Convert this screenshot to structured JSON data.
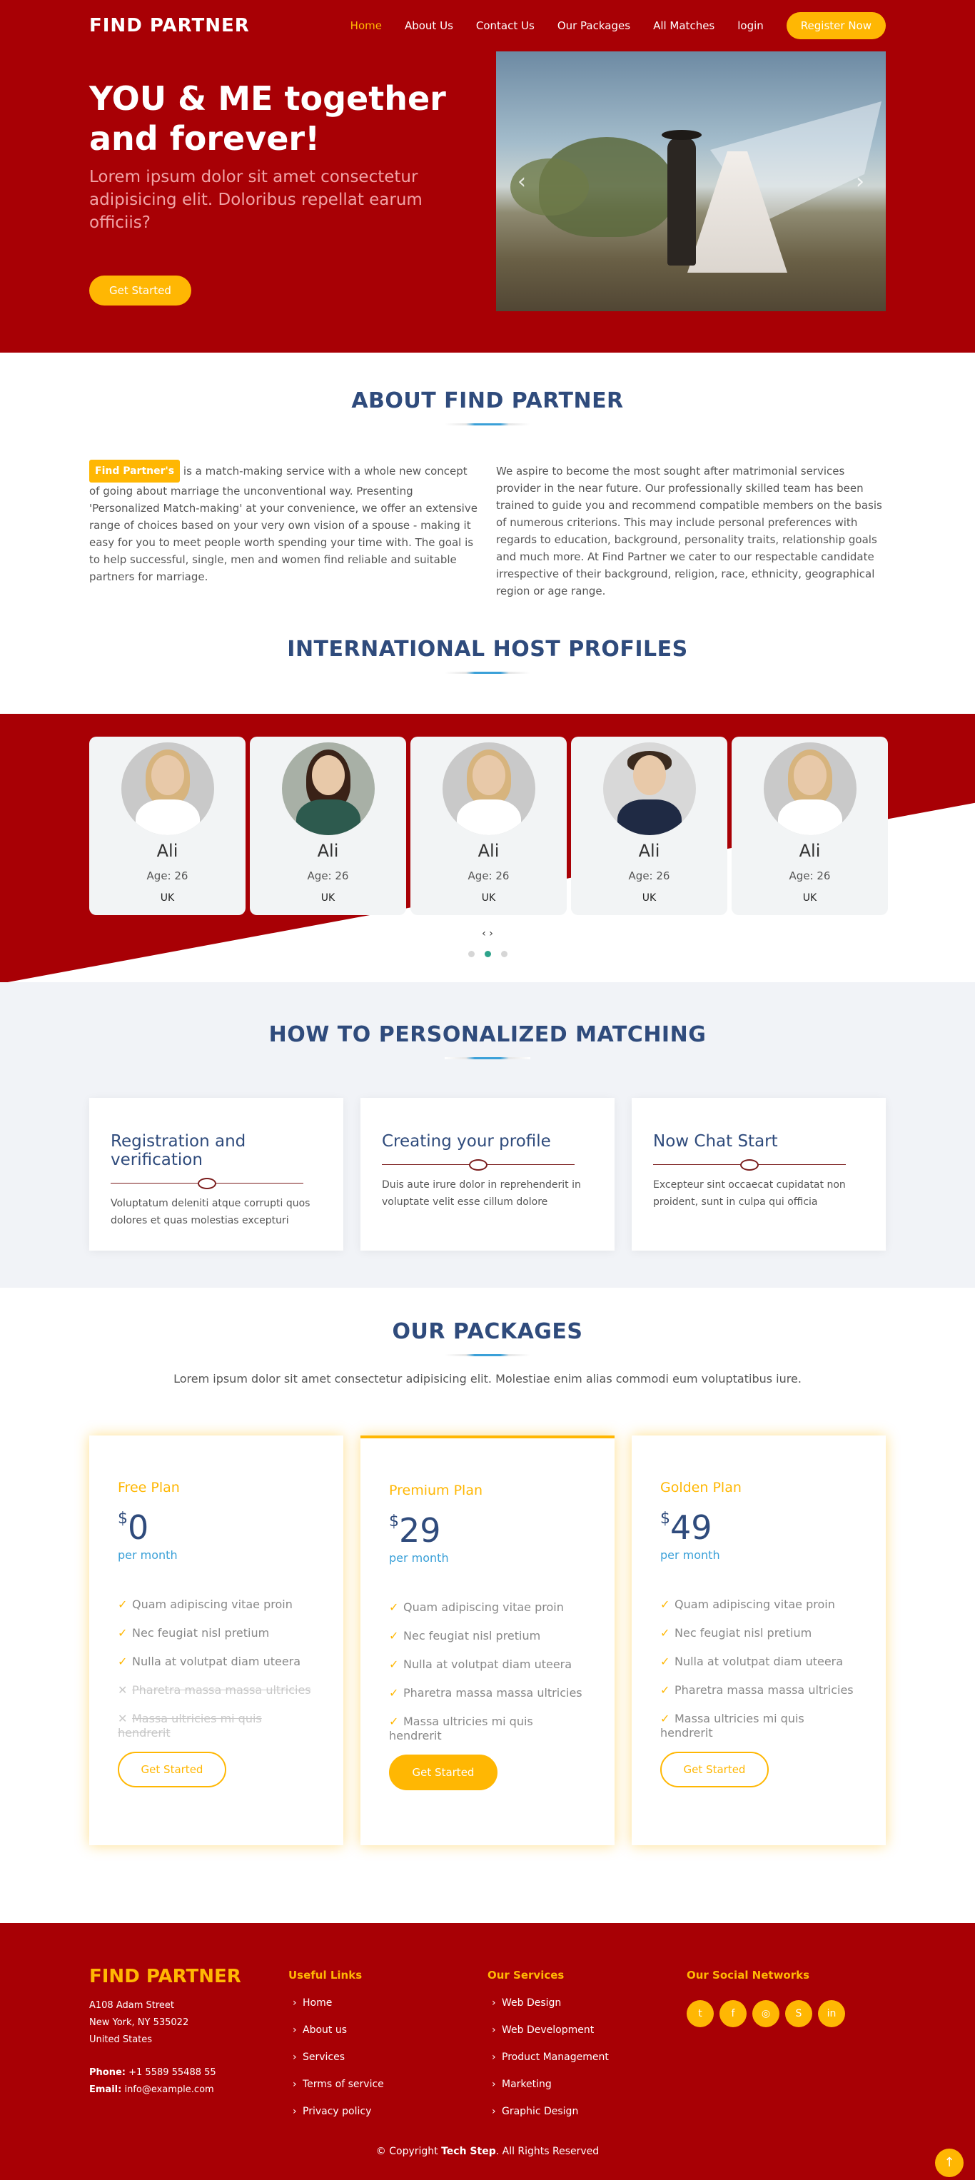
{
  "header": {
    "logo": "FIND PARTNER",
    "nav": [
      "Home",
      "About Us",
      "Contact Us",
      "Our Packages",
      "All Matches",
      "login"
    ],
    "register": "Register Now"
  },
  "hero": {
    "title": "YOU & ME together and forever!",
    "subtitle": "Lorem ipsum dolor sit amet consectetur adipisicing elit. Doloribus repellat earum officiis?",
    "cta": "Get Started",
    "prev": "‹",
    "next": "›"
  },
  "about": {
    "title": "ABOUT FIND PARTNER",
    "badge": "Find Partner's",
    "left_text": "is a match-making service with a whole new concept of going about marriage the unconventional way. Presenting 'Personalized Match-making' at your convenience, we offer an extensive range of choices based on your very own vision of a spouse - making it easy for you to meet people worth spending your time with. The goal is to help successful, single, men and women find reliable and suitable partners for marriage.",
    "right_text": "We aspire to become the most sought after matrimonial services provider in the near future. Our professionally skilled team has been trained to guide you and recommend compatible members on the basis of numerous criterions. This may include personal preferences with regards to education, background, personality traits, relationship goals and much more. At Find Partner we cater to our respectable candidate irrespective of their background, religion, race, ethnicity, geographical region or age range."
  },
  "profiles": {
    "title": "INTERNATIONAL HOST PROFILES",
    "items": [
      {
        "name": "Ali",
        "age": "Age: 26",
        "country": "UK"
      },
      {
        "name": "Ali",
        "age": "Age: 26",
        "country": "UK"
      },
      {
        "name": "Ali",
        "age": "Age: 26",
        "country": "UK"
      },
      {
        "name": "Ali",
        "age": "Age: 26",
        "country": "UK"
      },
      {
        "name": "Ali",
        "age": "Age: 26",
        "country": "UK"
      }
    ],
    "nav": "‹ ›"
  },
  "howto": {
    "title": "HOW TO PERSONALIZED MATCHING",
    "steps": [
      {
        "title": "Registration and verification",
        "text": "Voluptatum deleniti atque corrupti quos dolores et quas molestias excepturi"
      },
      {
        "title": "Creating your profile",
        "text": "Duis aute irure dolor in reprehenderit in voluptate velit esse cillum dolore"
      },
      {
        "title": "Now Chat Start",
        "text": "Excepteur sint occaecat cupidatat non proident, sunt in culpa qui officia"
      }
    ]
  },
  "packages": {
    "title": "OUR PACKAGES",
    "subtitle": "Lorem ipsum dolor sit amet consectetur adipisicing elit. Molestiae enim alias commodi eum voluptatibus iure.",
    "plans": [
      {
        "name": "Free Plan",
        "currency": "$",
        "price": "0",
        "period": "per month",
        "features": [
          "Quam adipiscing vitae proin",
          "Nec feugiat nisl pretium",
          "Nulla at volutpat diam uteera",
          "Pharetra massa massa ultricies",
          "Massa ultricies mi quis hendrerit"
        ],
        "button": "Get Started"
      },
      {
        "name": "Premium Plan",
        "currency": "$",
        "price": "29",
        "period": "per month",
        "features": [
          "Quam adipiscing vitae proin",
          "Nec feugiat nisl pretium",
          "Nulla at volutpat diam uteera",
          "Pharetra massa massa ultricies",
          "Massa ultricies mi quis hendrerit"
        ],
        "button": "Get Started"
      },
      {
        "name": "Golden Plan",
        "currency": "$",
        "price": "49",
        "period": "per month",
        "features": [
          "Quam adipiscing vitae proin",
          "Nec feugiat nisl pretium",
          "Nulla at volutpat diam uteera",
          "Pharetra massa massa ultricies",
          "Massa ultricies mi quis hendrerit"
        ],
        "button": "Get Started"
      }
    ]
  },
  "footer": {
    "logo": "FIND PARTNER",
    "address": [
      "A108 Adam Street",
      "New York, NY 535022",
      "United States"
    ],
    "phone_label": "Phone:",
    "phone": "+1 5589 55488 55",
    "email_label": "Email:",
    "email": "info@example.com",
    "useful_title": "Useful Links",
    "useful": [
      "Home",
      "About us",
      "Services",
      "Terms of service",
      "Privacy policy"
    ],
    "services_title": "Our Services",
    "services": [
      "Web Design",
      "Web Development",
      "Product Management",
      "Marketing",
      "Graphic Design"
    ],
    "social_title": "Our Social Networks",
    "copyright_pre": "© Copyright",
    "copyright_brand": "Tech Step",
    "copyright_post": ". All Rights Reserved"
  },
  "colors": {
    "brand_red": "#a80005",
    "accent_yellow": "#ffb703",
    "title_blue": "#2f4b7c",
    "link_blue": "#3aa0d8"
  }
}
